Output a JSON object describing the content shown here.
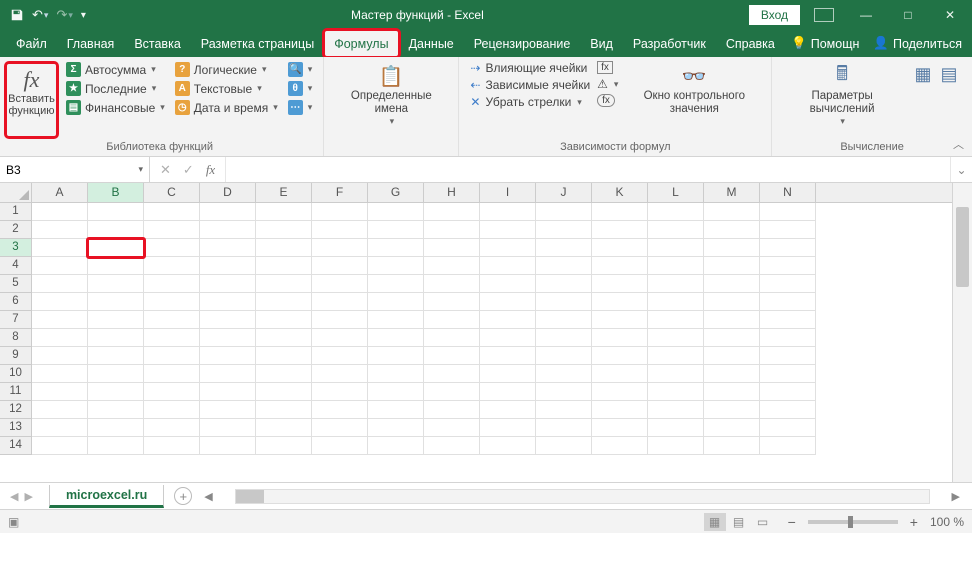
{
  "title": "Мастер функций  -  Excel",
  "signin": "Вход",
  "tabs": {
    "file": "Файл",
    "home": "Главная",
    "insert": "Вставка",
    "pagelayout": "Разметка страницы",
    "formulas": "Формулы",
    "data": "Данные",
    "review": "Рецензирование",
    "view": "Вид",
    "developer": "Разработчик",
    "help": "Справка"
  },
  "tabsright": {
    "tellme": "Помощн",
    "share": "Поделиться"
  },
  "ribbon": {
    "insert_function": "Вставить функцию",
    "lib": {
      "autosum": "Автосумма",
      "recent": "Последние",
      "financial": "Финансовые",
      "logical": "Логические",
      "text": "Текстовые",
      "datetime": "Дата и время",
      "lookup": "",
      "math": "",
      "more": ""
    },
    "lib_group": "Библиотека функций",
    "defined_names": "Определенные имена",
    "deps": {
      "trace_prec": "Влияющие ячейки",
      "trace_dep": "Зависимые ячейки",
      "remove_arrows": "Убрать стрелки"
    },
    "watch_window": "Окно контрольного значения",
    "deps_group": "Зависимости формул",
    "calc_options": "Параметры вычислений",
    "calc_group": "Вычисление"
  },
  "namebox": "B3",
  "formula": "",
  "columns": [
    "A",
    "B",
    "C",
    "D",
    "E",
    "F",
    "G",
    "H",
    "I",
    "J",
    "K",
    "L",
    "M",
    "N"
  ],
  "row_count": 14,
  "active_cell": {
    "row": 3,
    "col": 1
  },
  "sheet": "microexcel.ru",
  "zoom": "100 %"
}
